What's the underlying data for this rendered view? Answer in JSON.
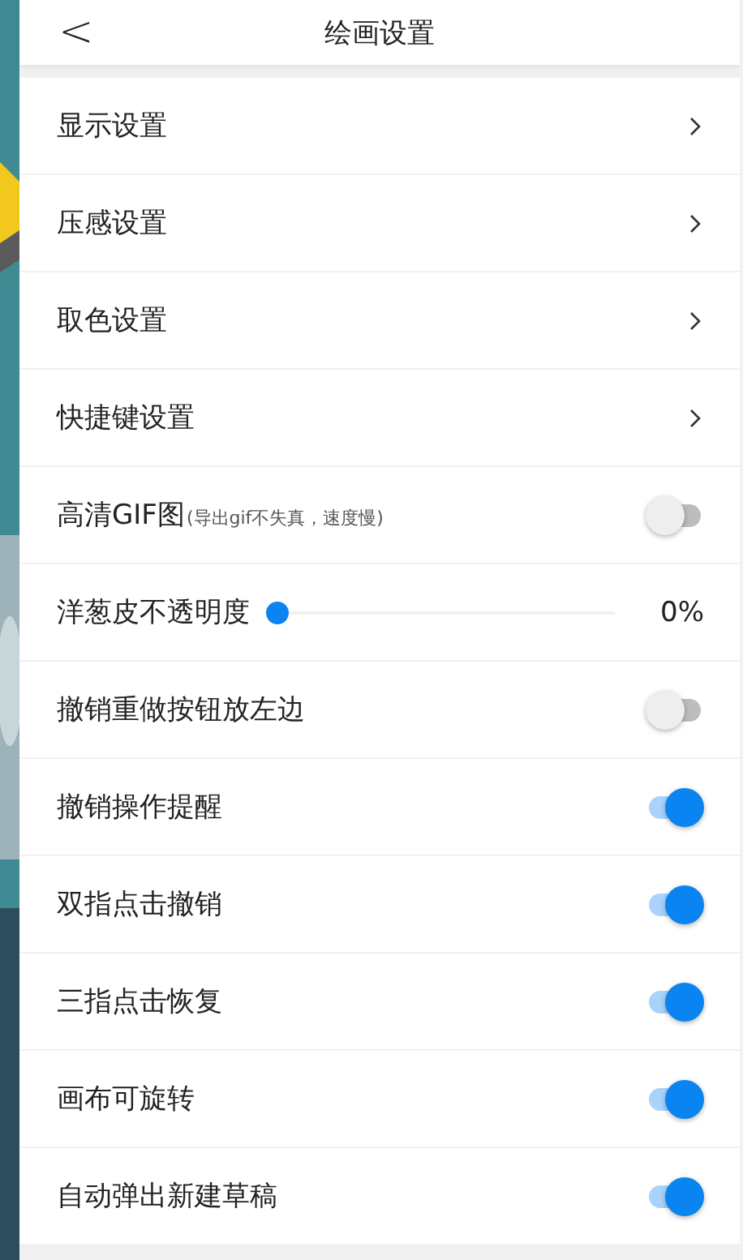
{
  "header": {
    "back": "<",
    "title": "绘画设置"
  },
  "rows": [
    {
      "kind": "link",
      "label": "显示设置"
    },
    {
      "kind": "link",
      "label": "压感设置"
    },
    {
      "kind": "link",
      "label": "取色设置"
    },
    {
      "kind": "link",
      "label": "快捷键设置"
    },
    {
      "kind": "toggle",
      "label": "高清GIF图",
      "note": "(导出gif不失真，速度慢)",
      "on": false
    },
    {
      "kind": "slider",
      "label": "洋葱皮不透明度",
      "level": 0,
      "reading": "0%"
    },
    {
      "kind": "toggle",
      "label": "撤销重做按钮放左边",
      "on": false
    },
    {
      "kind": "toggle",
      "label": "撤销操作提醒",
      "on": true
    },
    {
      "kind": "toggle",
      "label": "双指点击撤销",
      "on": true
    },
    {
      "kind": "toggle",
      "label": "三指点击恢复",
      "on": true
    },
    {
      "kind": "toggle",
      "label": "画布可旋转",
      "on": true
    },
    {
      "kind": "toggle",
      "label": "自动弹出新建草稿",
      "on": true
    }
  ]
}
